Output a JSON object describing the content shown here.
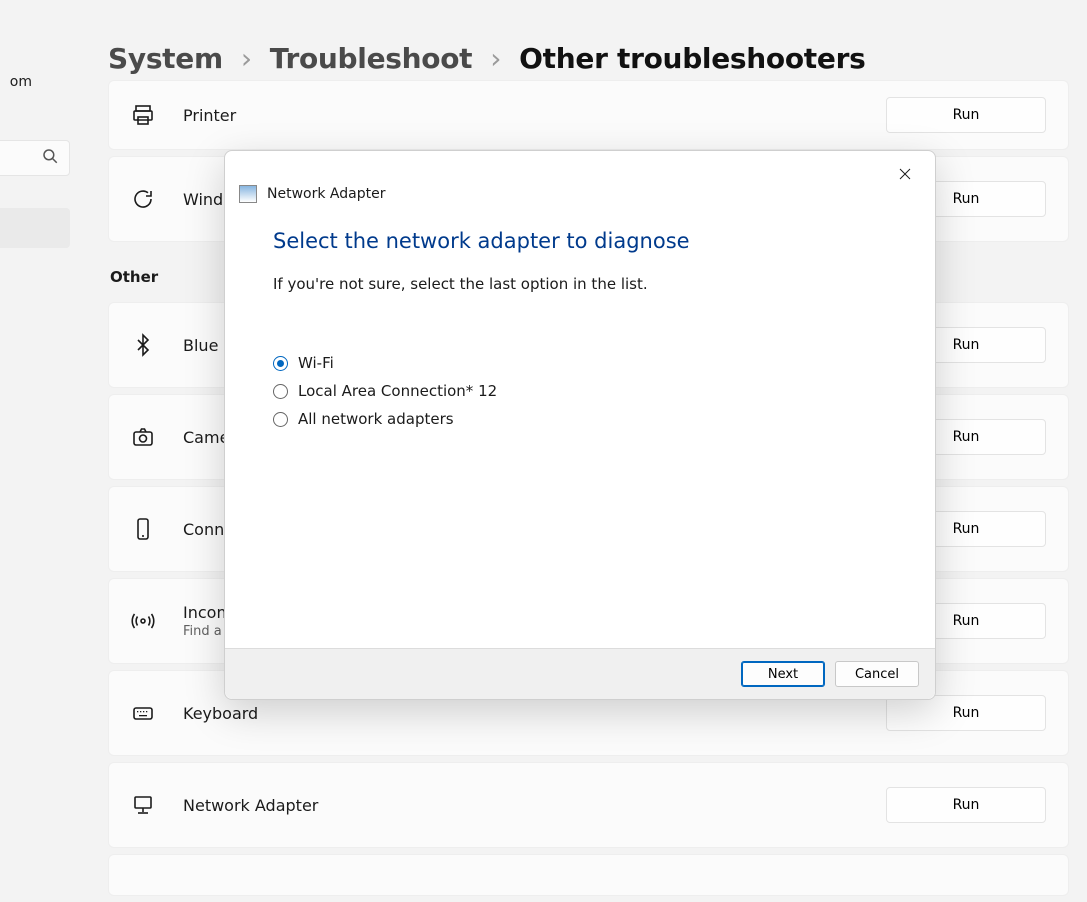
{
  "sidebar": {
    "label_fragment": "om"
  },
  "breadcrumb": {
    "lvl1": "System",
    "lvl2": "Troubleshoot",
    "lvl3": "Other troubleshooters"
  },
  "lists": {
    "most_frequent": [
      {
        "icon": "printer",
        "title": "Printer",
        "run": "Run"
      },
      {
        "icon": "refresh",
        "title": "Wind",
        "run": "Run"
      }
    ],
    "other_label": "Other",
    "other": [
      {
        "icon": "bluetooth",
        "title": "Blue",
        "sub": "",
        "run": "Run"
      },
      {
        "icon": "camera",
        "title": "Came",
        "sub": "",
        "run": "Run"
      },
      {
        "icon": "phone",
        "title": "Conn",
        "sub": "",
        "run": "Run"
      },
      {
        "icon": "broadcast",
        "title": "Incom",
        "sub": "Find a",
        "run": "Run"
      },
      {
        "icon": "keyboard",
        "title": "Keyboard",
        "sub": "",
        "run": "Run"
      },
      {
        "icon": "network",
        "title": "Network Adapter",
        "sub": "",
        "run": "Run"
      }
    ]
  },
  "dialog": {
    "caption": "Network Adapter",
    "heading": "Select the network adapter to diagnose",
    "description": "If you're not sure, select the last option in the list.",
    "options": [
      {
        "label": "Wi-Fi",
        "selected": true
      },
      {
        "label": "Local Area Connection* 12",
        "selected": false
      },
      {
        "label": "All network adapters",
        "selected": false
      }
    ],
    "next": "Next",
    "cancel": "Cancel"
  }
}
